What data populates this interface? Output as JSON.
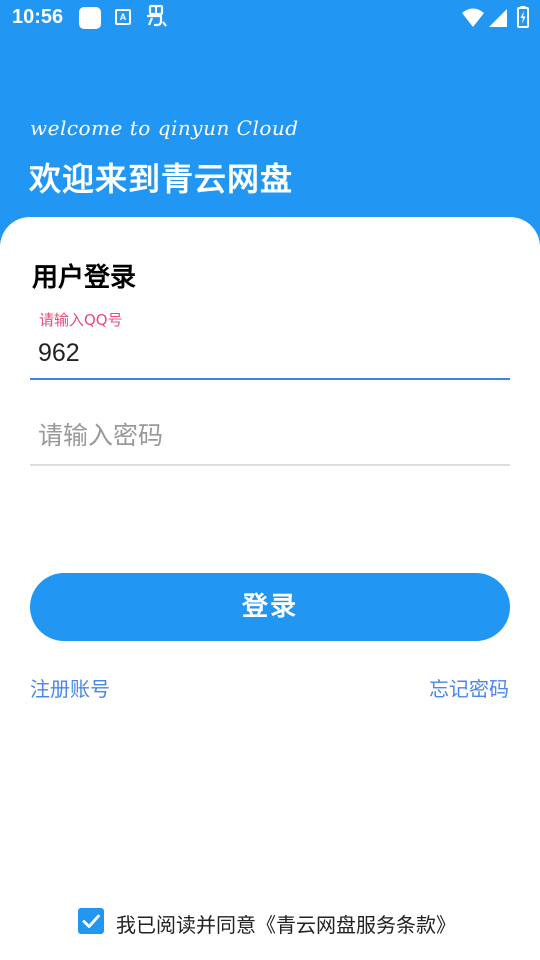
{
  "status_bar": {
    "time": "10:56",
    "icons": [
      "app-square-icon",
      "accessibility-a-icon",
      "bug-icon",
      "wifi-icon",
      "cell-signal-icon",
      "battery-icon"
    ]
  },
  "header": {
    "welcome": "welcome to qinyun Cloud",
    "title": "欢迎来到青云网盘"
  },
  "login": {
    "title": "用户登录",
    "qq_field": {
      "label": "请输入QQ号",
      "value": "962"
    },
    "password_field": {
      "placeholder": "请输入密码",
      "value": ""
    },
    "login_button": "登录",
    "register_link": "注册账号",
    "forgot_link": "忘记密码"
  },
  "agreement": {
    "checked": true,
    "text": "我已阅读并同意《青云网盘服务条款》"
  },
  "colors": {
    "primary": "#2196F3",
    "field_label": "#E84C78",
    "link": "#4A86E8",
    "active_underline": "#3F7FEF"
  }
}
